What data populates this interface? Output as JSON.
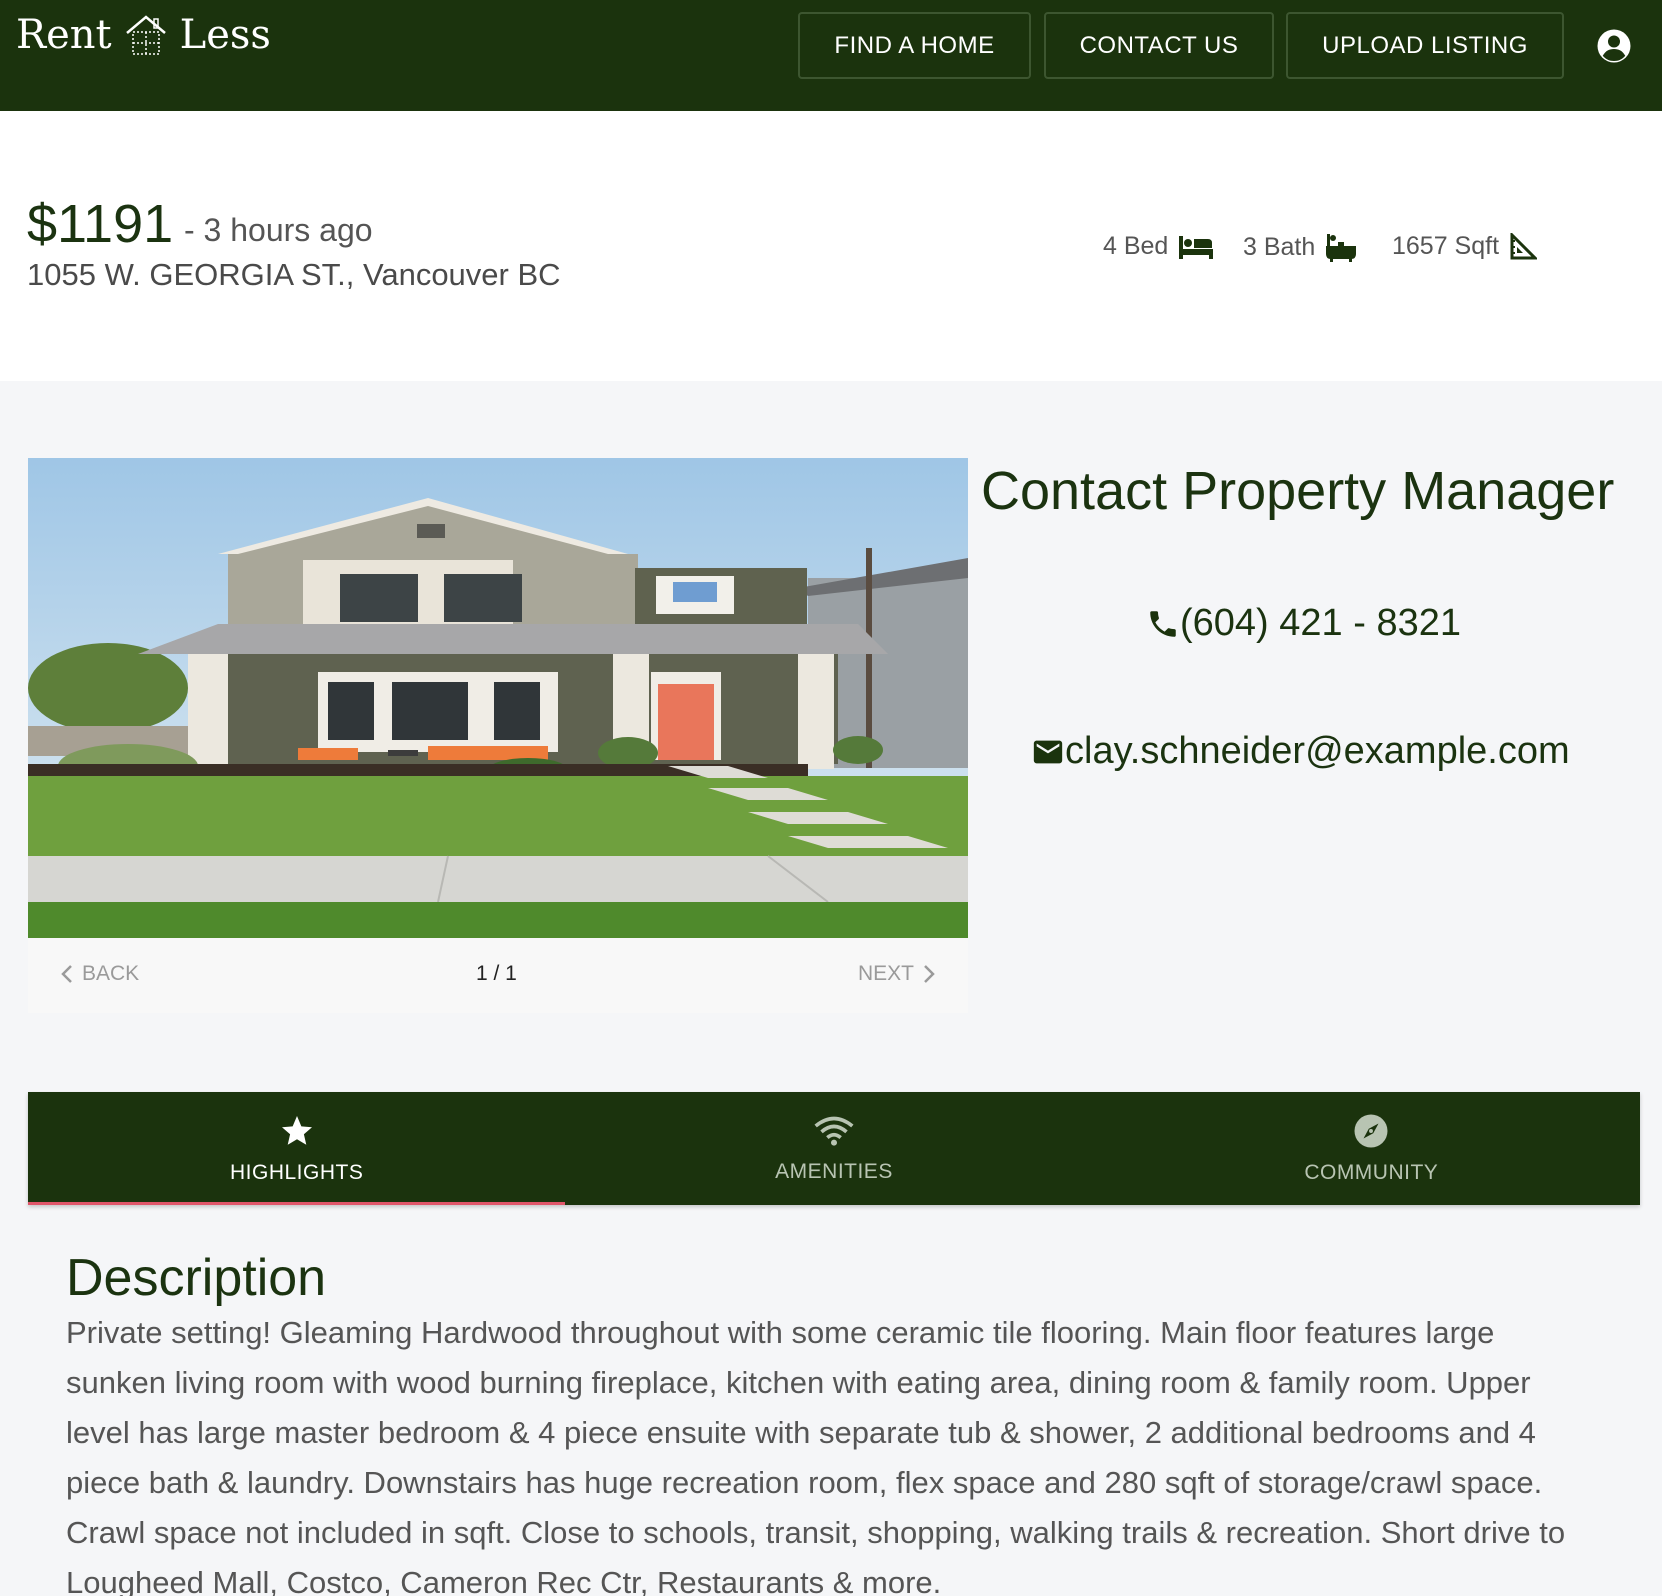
{
  "header": {
    "logo_left": "Rent",
    "logo_right": "Less",
    "logo_icon": "house-grid-icon",
    "nav": {
      "find_home": "FIND A HOME",
      "contact_us": "CONTACT US",
      "upload_listing": "UPLOAD LISTING"
    },
    "account_icon": "account-circle-icon"
  },
  "listing": {
    "price": "$1191",
    "posted": "- 3 hours ago",
    "address": "1055 W. GEORGIA ST., Vancouver BC",
    "beds": "4 Bed",
    "baths": "3 Bath",
    "sqft": "1657 Sqft"
  },
  "gallery": {
    "back_label": "BACK",
    "next_label": "NEXT",
    "counter": "1 / 1"
  },
  "contact": {
    "title": "Contact Property Manager",
    "phone": "(604) 421 - 8321",
    "email": "clay.schneider@example.com"
  },
  "tabs": [
    {
      "label": "HIGHLIGHTS",
      "icon": "star-icon",
      "active": true
    },
    {
      "label": "AMENITIES",
      "icon": "wifi-icon",
      "active": false
    },
    {
      "label": "COMMUNITY",
      "icon": "compass-icon",
      "active": false
    }
  ],
  "description": {
    "title": "Description",
    "body": "Private setting! Gleaming Hardwood throughout with some ceramic tile flooring. Main floor features large sunken living room with wood burning fireplace, kitchen with eating area, dining room & family room. Upper level has large master bedroom & 4 piece ensuite with separate tub & shower, 2 additional bedrooms and 4 piece bath & laundry. Downstairs has huge recreation room, flex space and 280 sqft of storage/crawl space. Crawl space not included in sqft. Close to schools, transit, shopping, walking trails & recreation. Short drive to Lougheed Mall, Costco, Cameron Rec Ctr, Restaurants & more."
  },
  "colors": {
    "brand_green": "#1b330d",
    "active_tab_indicator": "#e0566a",
    "door_orange": "#e9765b"
  }
}
